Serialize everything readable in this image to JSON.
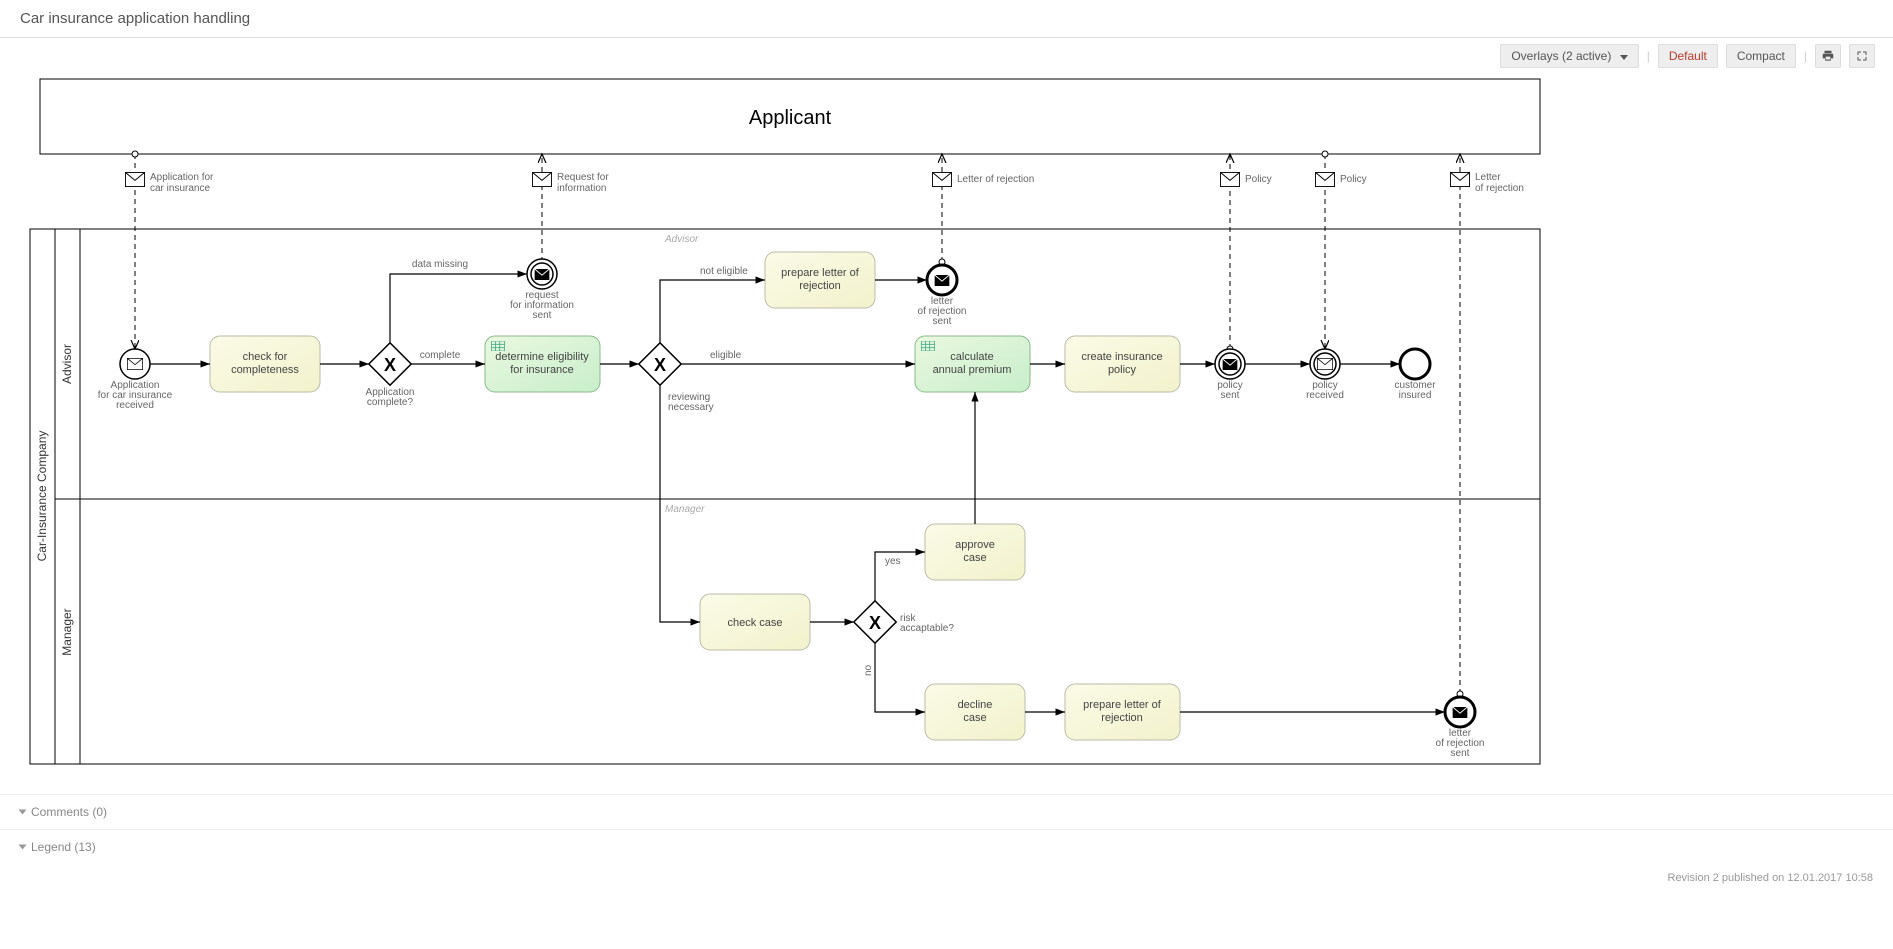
{
  "header": {
    "title": "Car insurance application handling"
  },
  "toolbar": {
    "overlays_label": "Overlays (2 active)",
    "default_label": "Default",
    "compact_label": "Compact"
  },
  "pools": {
    "applicant": "Applicant",
    "company": "Car-Insurance Company",
    "advisor": "Advisor",
    "manager": "Manager",
    "advisor_hint": "Advisor",
    "manager_hint": "Manager"
  },
  "messages": {
    "m1": "Application for\ncar insurance",
    "m2": "Request for\ninformation",
    "m3": "Letter of rejection",
    "m4": "Policy",
    "m5": "Policy",
    "m6": "Letter\nof rejection"
  },
  "events": {
    "start": "Application\nfor car insurance\nreceived",
    "req_info": "request\nfor information\nsent",
    "rej1": "letter\nof rejection\nsent",
    "policy_sent": "policy\nsent",
    "policy_recv": "policy\nreceived",
    "cust_ins": "customer\ninsured",
    "rej2": "letter\nof rejection\nsent"
  },
  "tasks": {
    "t1": "check for completeness",
    "t2": "determine eligibility for insurance",
    "t3": "prepare letter of rejection",
    "t4": "calculate annual premium",
    "t5": "create insurance policy",
    "t6": "check case",
    "t7": "approve case",
    "t8": "decline case",
    "t9": "prepare letter of rejection"
  },
  "gateways": {
    "g1": "Application\ncomplete?",
    "g2_label": "",
    "g3": "risk\naccaptable?"
  },
  "flow_labels": {
    "data_missing": "data missing",
    "complete": "complete",
    "not_eligible": "not eligible",
    "eligible": "eligible",
    "reviewing": "reviewing\nnecessary",
    "yes": "yes",
    "no": "no"
  },
  "footer": {
    "comments": "Comments (0)",
    "legend": "Legend (13)",
    "revision": "Revision 2 published on 12.01.2017 10:58"
  }
}
